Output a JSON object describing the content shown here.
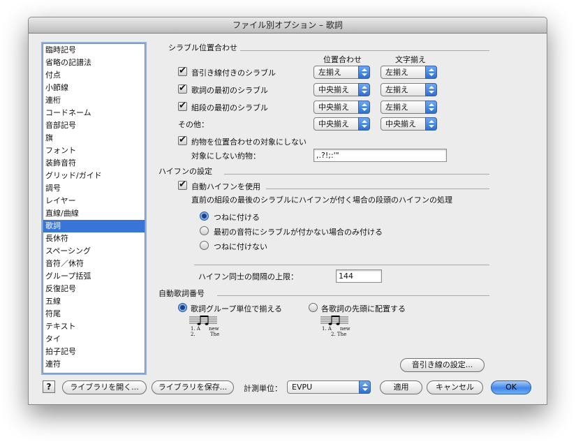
{
  "window": {
    "title": "ファイル別オプション – 歌詞"
  },
  "categories": [
    {
      "label": "臨時記号"
    },
    {
      "label": "省略の記譜法"
    },
    {
      "label": "付点"
    },
    {
      "label": "小節線"
    },
    {
      "label": "連桁"
    },
    {
      "label": "コードネーム"
    },
    {
      "label": "音部記号"
    },
    {
      "label": "旗"
    },
    {
      "label": "フォント"
    },
    {
      "label": "装飾音符"
    },
    {
      "label": "グリッド/ガイド"
    },
    {
      "label": "調号"
    },
    {
      "label": "レイヤー"
    },
    {
      "label": "直線/曲線"
    },
    {
      "label": "歌詞",
      "selected": true
    },
    {
      "label": "長休符"
    },
    {
      "label": "スペーシング"
    },
    {
      "label": "音符／休符"
    },
    {
      "label": "グループ括弧"
    },
    {
      "label": "反復記号"
    },
    {
      "label": "五線"
    },
    {
      "label": "符尾"
    },
    {
      "label": "テキスト"
    },
    {
      "label": "タイ"
    },
    {
      "label": "拍子記号"
    },
    {
      "label": "連符"
    }
  ],
  "syllable": {
    "header": "シラブル位置合わせ",
    "col_position": "位置合わせ",
    "col_char": "文字揃え",
    "rows": [
      {
        "label": "音引き線付きのシラブル",
        "checked": true,
        "position": "左揃え",
        "char": "左揃え"
      },
      {
        "label": "歌詞の最初のシラブル",
        "checked": true,
        "position": "中央揃え",
        "char": "左揃え"
      },
      {
        "label": "組段の最初のシラブル",
        "checked": true,
        "position": "中央揃え",
        "char": "左揃え"
      }
    ],
    "other_label": "その他：",
    "other_position": "中央揃え",
    "other_char": "中央揃え",
    "punct_check_label": "約物を位置合わせの対象にしない",
    "punct_checked": true,
    "punct_field_label": "対象にしない約物：",
    "punct_field_value": ",.?!;:'\""
  },
  "hyphen": {
    "header": "ハイフンの設定",
    "auto_label": "自動ハイフンを使用",
    "auto_checked": true,
    "description": "直前の組段の最後のシラブルにハイフンが付く場合の段頭のハイフンの処理",
    "options": [
      {
        "label": "つねに付ける",
        "selected": true
      },
      {
        "label": "最初の音符にシラブルが付かない場合のみ付ける",
        "selected": false
      },
      {
        "label": "つねに付けない",
        "selected": false
      }
    ],
    "max_gap_label": "ハイフン同士の間隔の上限：",
    "max_gap_value": "144"
  },
  "verse_numbers": {
    "header": "自動歌詞番号",
    "options": [
      {
        "label": "歌詞グループ単位で揃える",
        "selected": true
      },
      {
        "label": "各歌詞の先頭に配置する",
        "selected": false
      }
    ],
    "sample_a": {
      "line1": "1. A",
      "word1": "new",
      "line2": "2.",
      "word2": "The"
    },
    "sample_b": {
      "line1": "1. A",
      "word1": "new",
      "line2": "2. The"
    }
  },
  "buttons": {
    "extender_settings": "音引き線の設定...",
    "help": "?",
    "open_library": "ライブラリを開く...",
    "save_library": "ライブラリを保存...",
    "unit_label": "計測単位：",
    "unit_value": "EVPU",
    "apply": "適用",
    "cancel": "キャンセル",
    "ok": "OK"
  },
  "colors": {
    "selection": "#3875d7",
    "default_button": "#3f86e8",
    "popup_arrow": "#2f6fd0"
  }
}
